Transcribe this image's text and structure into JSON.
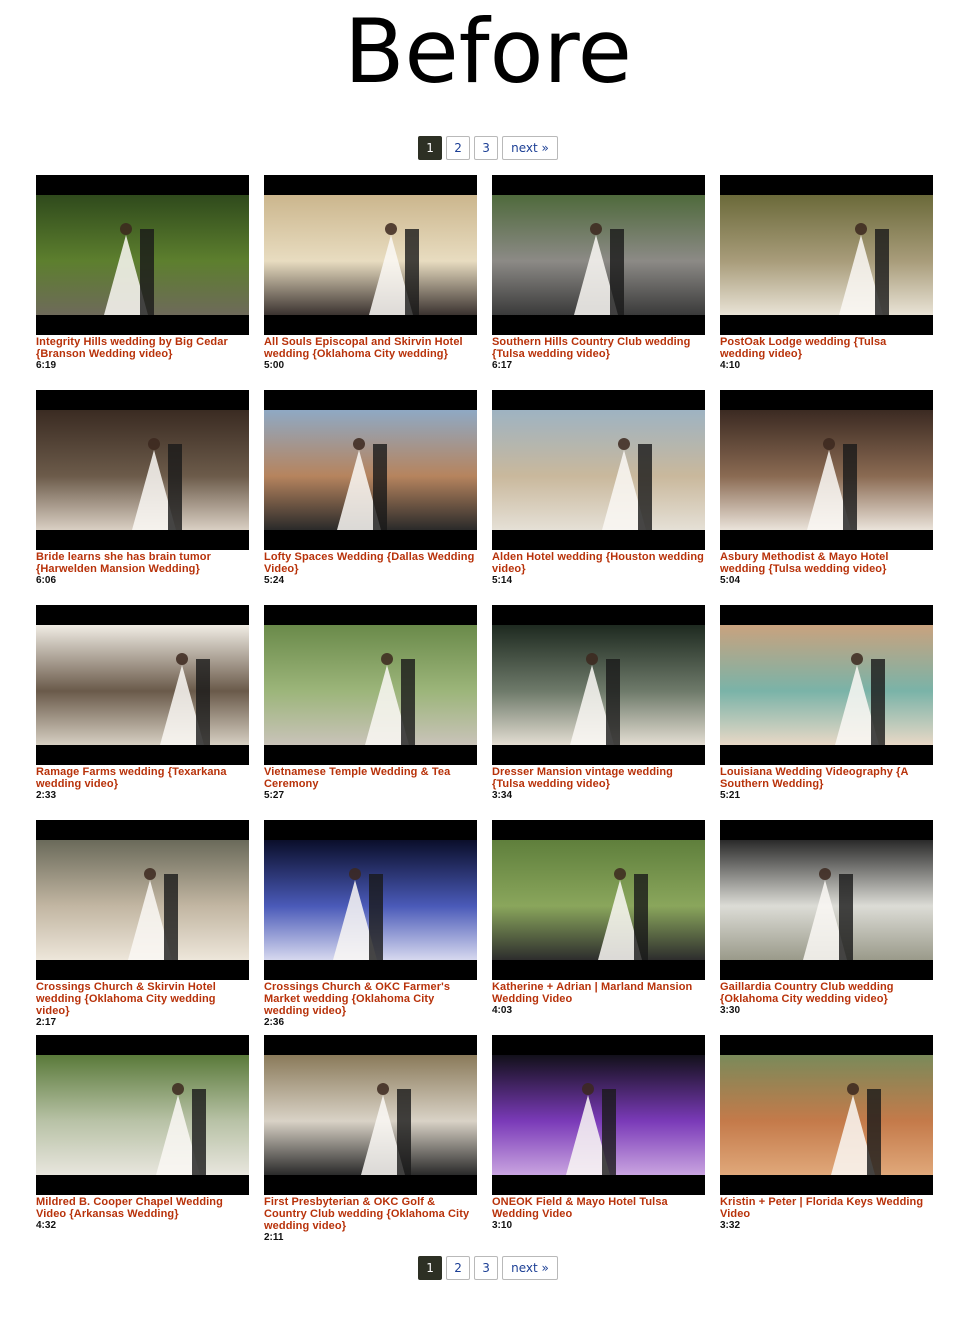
{
  "heading": "Before",
  "pagination": {
    "pages": [
      "1",
      "2",
      "3"
    ],
    "active": "1",
    "next_label": "next »"
  },
  "videos": [
    {
      "title": "Integrity Hills wedding by Big Cedar {Branson Wedding video}",
      "duration": "6:19"
    },
    {
      "title": "All Souls Episcopal and Skirvin Hotel wedding {Oklahoma City wedding}",
      "duration": "5:00"
    },
    {
      "title": "Southern Hills Country Club wedding {Tulsa wedding video}",
      "duration": "6:17"
    },
    {
      "title": "PostOak Lodge wedding {Tulsa wedding video}",
      "duration": "4:10"
    },
    {
      "title": "Bride learns she has brain tumor {Harwelden Mansion Wedding}",
      "duration": "6:06"
    },
    {
      "title": "Lofty Spaces Wedding {Dallas Wedding Video}",
      "duration": "5:24"
    },
    {
      "title": "Alden Hotel wedding {Houston wedding video}",
      "duration": "5:14"
    },
    {
      "title": "Asbury Methodist & Mayo Hotel wedding {Tulsa wedding video}",
      "duration": "5:04"
    },
    {
      "title": "Ramage Farms wedding {Texarkana wedding video}",
      "duration": "2:33"
    },
    {
      "title": "Vietnamese Temple Wedding & Tea Ceremony",
      "duration": "5:27"
    },
    {
      "title": "Dresser Mansion vintage wedding {Tulsa wedding video}",
      "duration": "3:34"
    },
    {
      "title": "Louisiana Wedding Videography {A Southern Wedding}",
      "duration": "5:21"
    },
    {
      "title": "Crossings Church & Skirvin Hotel wedding {Oklahoma City wedding video}",
      "duration": "2:17"
    },
    {
      "title": "Crossings Church & OKC Farmer's Market wedding {Oklahoma City wedding video}",
      "duration": "2:36"
    },
    {
      "title": "Katherine + Adrian | Marland Mansion Wedding Video",
      "duration": "4:03"
    },
    {
      "title": "Gaillardia Country Club wedding {Oklahoma City wedding video}",
      "duration": "3:30"
    },
    {
      "title": "Mildred B. Cooper Chapel Wedding Video {Arkansas Wedding}",
      "duration": "4:32"
    },
    {
      "title": "First Presbyterian & OKC Golf & Country Club wedding {Oklahoma City wedding video}",
      "duration": "2:11"
    },
    {
      "title": "ONEOK Field & Mayo Hotel Tulsa Wedding Video",
      "duration": "3:10"
    },
    {
      "title": "Kristin + Peter | Florida Keys Wedding Video",
      "duration": "3:32"
    }
  ],
  "colors": {
    "title_text": "#b8320a",
    "pager_active_bg": "#2d3024",
    "pager_link": "#1c3f95"
  }
}
